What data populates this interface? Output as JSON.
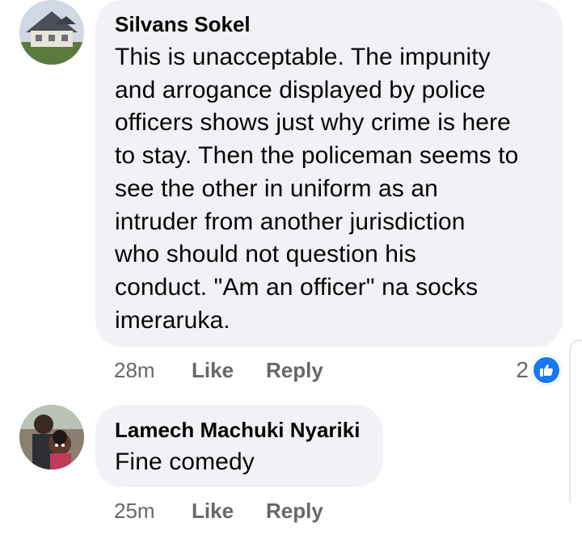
{
  "comments": [
    {
      "author": "Silvans Sokel",
      "text": "This is unacceptable.  The impunity\nand arrogance displayed by police\nofficers shows just why crime is here\nto stay. Then the policeman seems to\nsee the other in uniform as an\nintruder from another jurisdiction\nwho should not question his\nconduct. \"Am an officer\" na socks\nimeraruka.",
      "time": "28m",
      "like_label": "Like",
      "reply_label": "Reply",
      "reaction_count": "2",
      "reaction_icon": "like-thumb-icon"
    },
    {
      "author": "Lamech Machuki Nyariki",
      "text": "Fine comedy",
      "time": "25m",
      "like_label": "Like",
      "reply_label": "Reply"
    }
  ],
  "colors": {
    "bubble": "#f0f2f5",
    "meta_text": "#65676b",
    "like_blue": "#1877f2"
  }
}
